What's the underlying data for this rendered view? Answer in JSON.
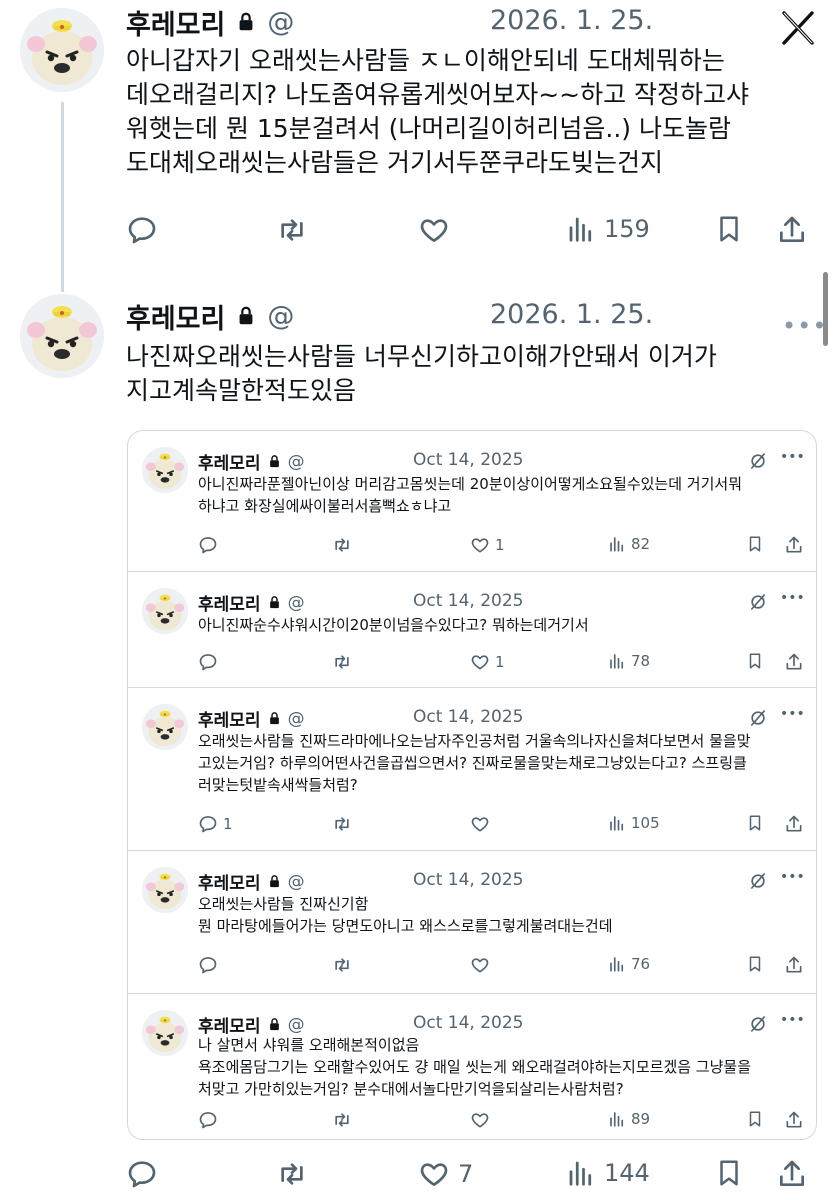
{
  "close_label": "X",
  "tweets": [
    {
      "name": "후레모리",
      "handle": "@",
      "date": "2026. 1. 25.",
      "text": "아니갑자기 오래씻는사람들 ㅈㄴ이해안되네 도대체뭐하는\n데오래걸리지? 나도좀여유롭게씻어보자~~하고 작정하고샤\n워햇는데 뭔 15분걸려서 (나머리길이허리넘음..) 나도놀람\n도대체오래씻는사람들은 거기서두쭌쿠라도빚는건지",
      "views": "159",
      "likes": "",
      "replies": "",
      "retweets": ""
    },
    {
      "name": "후레모리",
      "handle": "@",
      "date": "2026. 1. 25.",
      "text": "나진짜오래씻는사람들 너무신기하고이해가안돼서 이거가\n지고계속말한적도있음",
      "replies": "",
      "retweets": "",
      "likes": "7",
      "views": "144"
    }
  ],
  "quoted": [
    {
      "name": "후레모리",
      "handle": "@",
      "date": "Oct 14, 2025",
      "text": "아니진짜라푼젤아닌이상 머리감고몸씻는데 20분이상이어떻게소요될수있는데 거기서뭐\n하냐고 화장실에싸이불러서흠뻑쇼ㅎ냐고",
      "replies": "",
      "retweets": "",
      "likes": "1",
      "views": "82"
    },
    {
      "name": "후레모리",
      "handle": "@",
      "date": "Oct 14, 2025",
      "text": "아니진짜순수샤워시간이20분이넘을수있다고? 뭐하는데거기서",
      "replies": "",
      "retweets": "",
      "likes": "1",
      "views": "78"
    },
    {
      "name": "후레모리",
      "handle": "@",
      "date": "Oct 14, 2025",
      "text": "오래씻는사람들 진짜드라마에나오는남자주인공처럼 거울속의나자신을쳐다보면서 물을맞\n고있는거임? 하루의어떤사건을곱씹으면서? 진짜로물을맞는채로그냥있는다고? 스프링클\n러맞는텃밭속새싹들처럼?",
      "replies": "1",
      "retweets": "",
      "likes": "",
      "views": "105"
    },
    {
      "name": "후레모리",
      "handle": "@",
      "date": "Oct 14, 2025",
      "text": "오래씻는사람들 진짜신기함\n뭔 마라탕에들어가는 당면도아니고 왜스스로를그렇게불려대는건데",
      "replies": "",
      "retweets": "",
      "likes": "",
      "views": "76"
    },
    {
      "name": "후레모리",
      "handle": "@",
      "date": "Oct 14, 2025",
      "text": "나 살면서 샤워를 오래해본적이없음\n욕조에몸담그기는 오래할수있어도 걍 매일 씻는게 왜오래걸려야하는지모르겠음 그냥물을\n처맞고 가만히있는거임? 분수대에서놀다만기억을되살리는사람처럼?",
      "replies": "",
      "retweets": "",
      "likes": "",
      "views": "89"
    }
  ]
}
